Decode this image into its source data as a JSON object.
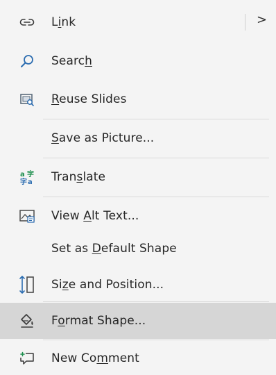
{
  "menu": {
    "items": [
      {
        "id": "link",
        "label": "Link",
        "icon": "link-icon",
        "has_submenu": true,
        "accesskey": "i"
      },
      {
        "id": "search",
        "label": "Search",
        "icon": "search-icon",
        "accesskey": "h"
      },
      {
        "id": "reuse-slides",
        "label": "Reuse Slides",
        "icon": "reuse-slides-icon",
        "accesskey": "R"
      },
      {
        "id": "save-as-picture",
        "label": "Save as Picture...",
        "icon": "",
        "accesskey": "S"
      },
      {
        "id": "translate",
        "label": "Translate",
        "icon": "translate-icon",
        "accesskey": "s"
      },
      {
        "id": "view-alt-text",
        "label": "View Alt Text...",
        "icon": "alt-text-icon",
        "accesskey": "A"
      },
      {
        "id": "set-default-shape",
        "label": "Set as Default Shape",
        "icon": "",
        "accesskey": "D"
      },
      {
        "id": "size-position",
        "label": "Size and Position...",
        "icon": "size-position-icon",
        "accesskey": "z"
      },
      {
        "id": "format-shape",
        "label": "Format Shape...",
        "icon": "format-shape-icon",
        "accesskey": "o",
        "highlighted": true
      },
      {
        "id": "new-comment",
        "label": "New Comment",
        "icon": "new-comment-icon",
        "accesskey": "m"
      }
    ],
    "submenu_chevron": ">"
  },
  "colors": {
    "accent_blue": "#2b6cb0",
    "translate_green": "#1e8f4e",
    "highlight": "#d6d6d6"
  }
}
